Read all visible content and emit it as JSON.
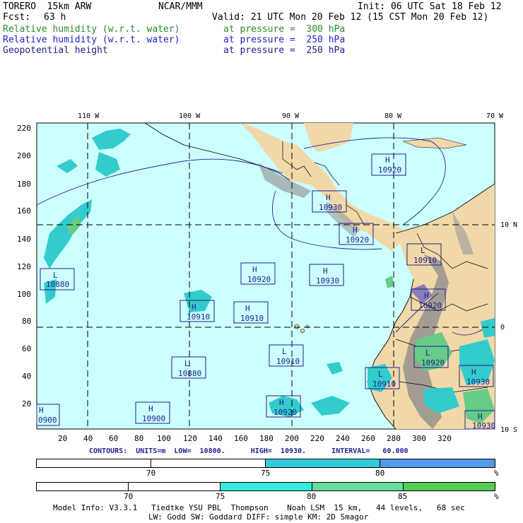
{
  "header": {
    "model": "TORERO  15km ARW",
    "org": "NCAR/MMM",
    "init": "Init: 06 UTC Sat 18 Feb 12",
    "fcst_label": "Fcst:",
    "fcst_value": "63 h",
    "valid": "Valid: 21 UTC Mon 20 Feb 12 (15 CST Mon 20 Feb 12)",
    "fields": [
      {
        "name": "Relative humidity (w.r.t. water)",
        "level": "at pressure =  300 hPa",
        "color": "#2c8a2c"
      },
      {
        "name": "Relative humidity (w.r.t. water)",
        "level": "at pressure =  250 hPa",
        "color": "#2222cc"
      },
      {
        "name": "Geopotential height",
        "level": "at pressure =  250 hPa",
        "color": "#22228a"
      }
    ]
  },
  "map": {
    "top_lon_labels": [
      "110 W",
      "100 W",
      "90 W",
      "80 W",
      "70 W"
    ],
    "right_lat_labels": [
      "10 N",
      "0",
      "10 S"
    ],
    "y_ticks": [
      "220",
      "200",
      "180",
      "160",
      "140",
      "120",
      "100",
      "80",
      "60",
      "40",
      "20"
    ],
    "x_ticks": [
      "20",
      "40",
      "60",
      "80",
      "100",
      "120",
      "140",
      "160",
      "180",
      "200",
      "220",
      "240",
      "260",
      "280",
      "300",
      "320"
    ],
    "colors": {
      "ocean": "#ccffff",
      "land": "#f0d8a8",
      "terrain": "#9a9a9a",
      "humid_cyan": "#33cccc",
      "humid_green": "#66cc88"
    },
    "highs_lows": [
      {
        "type": "L",
        "value": "10880"
      },
      {
        "type": "H",
        "value": "10920"
      },
      {
        "type": "H",
        "value": "10930"
      },
      {
        "type": "H",
        "value": "10920"
      },
      {
        "type": "H",
        "value": "10930"
      },
      {
        "type": "H",
        "value": "10920"
      },
      {
        "type": "H",
        "value": "10910"
      },
      {
        "type": "H",
        "value": "10910"
      },
      {
        "type": "L",
        "value": "10910"
      },
      {
        "type": "H",
        "value": "10920"
      },
      {
        "type": "L",
        "value": "10910"
      },
      {
        "type": "L",
        "value": "10880"
      },
      {
        "type": "L",
        "value": "10920"
      },
      {
        "type": "L",
        "value": "10910"
      },
      {
        "type": "H",
        "value": "10930"
      },
      {
        "type": "H",
        "value": "0900"
      },
      {
        "type": "H",
        "value": "10900"
      },
      {
        "type": "H",
        "value": "10920"
      },
      {
        "type": "H",
        "value": "10930"
      }
    ]
  },
  "contours_line": "CONTOURS:  UNITS=m  LOW=  10800.      HIGH=  10930.      INTERVAL=   60.000",
  "legend_bars": [
    {
      "labels": [
        "70",
        "75",
        "80"
      ],
      "unit": "%",
      "colors": [
        "#ffffff",
        "#ffffff",
        "#33ccdd",
        "#5599ee"
      ]
    },
    {
      "labels": [
        "70",
        "75",
        "80",
        "85"
      ],
      "unit": "%",
      "colors": [
        "#ffffff",
        "#ffffff",
        "#33eedd",
        "#66dd99",
        "#55cc55"
      ]
    }
  ],
  "footer": {
    "line1": "Model Info: V3.3.1   Tiedtke YSU PBL  Thompson    Noah LSM  15 km,   44 levels,   68 sec",
    "line2": "LW: Godd SW: Goddard DIFF: simple KM: 2D Smagor"
  }
}
